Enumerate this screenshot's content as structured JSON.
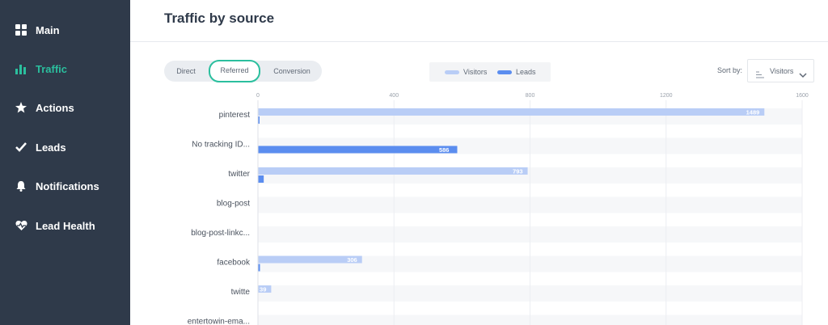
{
  "sidebar": {
    "items": [
      {
        "label": "Main",
        "icon": "grid-icon",
        "active": false
      },
      {
        "label": "Traffic",
        "icon": "bar-chart-icon",
        "active": true
      },
      {
        "label": "Actions",
        "icon": "star-icon",
        "active": false
      },
      {
        "label": "Leads",
        "icon": "check-icon",
        "active": false
      },
      {
        "label": "Notifications",
        "icon": "bell-icon",
        "active": false
      },
      {
        "label": "Lead Health",
        "icon": "heart-pulse-icon",
        "active": false
      }
    ]
  },
  "header": {
    "title": "Traffic by source"
  },
  "tabs": {
    "direct": "Direct",
    "referred": "Referred",
    "conversion": "Conversion",
    "active": "Referred"
  },
  "legend": {
    "visitors": "Visitors",
    "leads": "Leads"
  },
  "sort": {
    "label": "Sort by:",
    "value": "Visitors"
  },
  "colors": {
    "sidebar": "#2f3a4a",
    "accent": "#2bbf9e",
    "visitors": "#b9cdf6",
    "leads": "#5b8def",
    "rowBand": "#f6f7f9"
  },
  "chart_data": {
    "type": "bar",
    "orientation": "horizontal",
    "categories": [
      "pinterest",
      "No tracking ID...",
      "twitter",
      "blog-post",
      "blog-post-linkc...",
      "facebook",
      "twitte",
      "entertowin-ema..."
    ],
    "series": [
      {
        "name": "Visitors",
        "values": [
          1489,
          0,
          793,
          0,
          0,
          306,
          39,
          null
        ]
      },
      {
        "name": "Leads",
        "values": [
          3,
          586,
          17,
          0,
          0,
          6,
          0,
          null
        ]
      }
    ],
    "data_labels": [
      "1489",
      "586",
      "793",
      "306",
      "39"
    ],
    "xticks": [
      "0",
      "400",
      "800",
      "1200",
      "1600"
    ],
    "xlim": [
      0,
      1600
    ],
    "grid": true
  }
}
